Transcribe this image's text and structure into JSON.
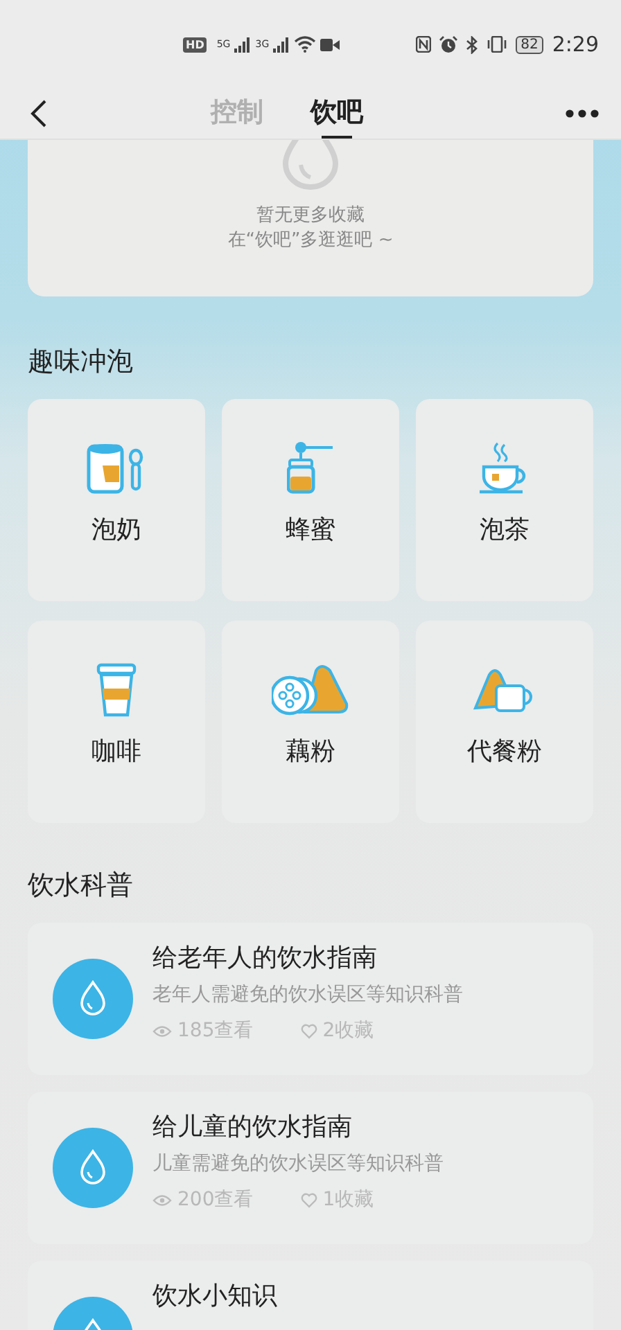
{
  "status_bar": {
    "network_labels": [
      "HD",
      "5G",
      "3G"
    ],
    "battery": "82",
    "time": "2:29"
  },
  "tabs": [
    {
      "label": "控制",
      "selected": false
    },
    {
      "label": "饮吧",
      "selected": true
    }
  ],
  "empty_favorites": {
    "line_1": "暂无更多收藏",
    "line_2": "在“饮吧”多逛逛吧 ~"
  },
  "fun_brewing": {
    "title": "趣味冲泡",
    "items": [
      {
        "label": "泡奶"
      },
      {
        "label": "蜂蜜"
      },
      {
        "label": "泡茶"
      },
      {
        "label": "咖啡"
      },
      {
        "label": "藕粉"
      },
      {
        "label": "代餐粉"
      }
    ]
  },
  "drinking_science": {
    "title": "饮水科普",
    "articles": [
      {
        "title": "给老年人的饮水指南",
        "subtitle": "老年人需避免的饮水误区等知识科普",
        "views": "185查看",
        "favorites": "2收藏"
      },
      {
        "title": "给儿童的饮水指南",
        "subtitle": "儿童需避免的饮水误区等知识科普",
        "views": "200查看",
        "favorites": "1收藏"
      },
      {
        "title": "饮水小知识"
      }
    ]
  }
}
